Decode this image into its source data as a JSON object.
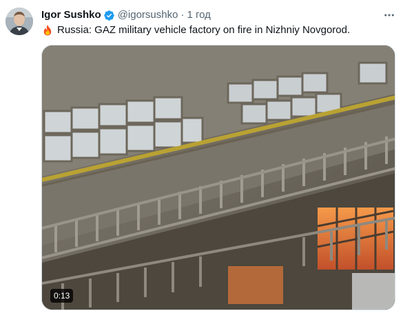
{
  "author": {
    "name": "Igor Sushko",
    "handle": "@igorsushko",
    "separator": "·",
    "time": "1 год",
    "verified": true
  },
  "tweet": {
    "emoji_icon": "fire-emoji-icon",
    "text": "Russia: GAZ military vehicle factory on fire in Nizhniy Novgorod."
  },
  "media": {
    "type": "video",
    "duration": "0:13"
  },
  "icons": {
    "verified": "verified-badge-icon",
    "more": "more-options-icon"
  },
  "colors": {
    "text_primary": "#0f1419",
    "text_secondary": "#536471",
    "verified_blue": "#1d9bf0",
    "border": "#cfd9de"
  }
}
